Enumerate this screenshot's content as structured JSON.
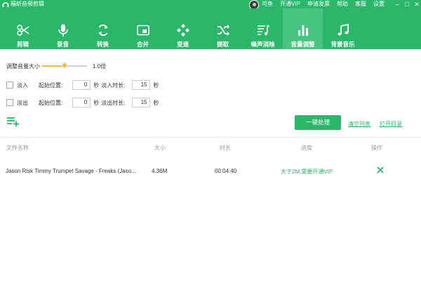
{
  "app": {
    "title": "福昕音频剪辑",
    "top_links": [
      "可鱼",
      "开通VIP",
      "申请发票",
      "帮助",
      "客服",
      "设置"
    ],
    "accent_color": "#2bb66a",
    "slider_color": "#f6b73c"
  },
  "toolbar": {
    "tools": [
      {
        "label": "剪辑",
        "icon": "scissors-icon"
      },
      {
        "label": "录音",
        "icon": "microphone-icon"
      },
      {
        "label": "转换",
        "icon": "convert-icon"
      },
      {
        "label": "合并",
        "icon": "merge-icon"
      },
      {
        "label": "变速",
        "icon": "speed-icon"
      },
      {
        "label": "提取",
        "icon": "extract-icon"
      },
      {
        "label": "噪声消除",
        "icon": "noise-removal-icon"
      },
      {
        "label": "音量调整",
        "icon": "volume-bars-icon",
        "active": true
      },
      {
        "label": "背景音乐",
        "icon": "music-note-icon"
      }
    ]
  },
  "volume": {
    "label": "调整音量大小",
    "value_text": "1.0倍",
    "level": 0.5
  },
  "fade_in": {
    "checkbox_label": "淡入",
    "start_label": "起始位置:",
    "start_value": "0",
    "unit1": "秒",
    "duration_label": "淡入时长:",
    "duration_value": "15",
    "unit2": "秒"
  },
  "fade_out": {
    "checkbox_label": "淡出",
    "start_label": "起始位置:",
    "start_value": "0",
    "unit1": "秒",
    "duration_label": "淡出时长:",
    "duration_value": "15",
    "unit2": "秒"
  },
  "actions": {
    "process_button": "一键处理",
    "clear_list": "清空列表",
    "open_folder": "打开目录"
  },
  "table": {
    "headers": [
      "文件名称",
      "大小",
      "时长",
      "进度",
      "操作"
    ],
    "rows": [
      {
        "name": "Jason Risk Timmy Trumpet Savage - Freaks (Jaso...",
        "size": "4.36M",
        "duration": "00:04:40",
        "progress": "大于2M,需要开通VIP",
        "action_icon": "close-x-icon"
      }
    ]
  }
}
